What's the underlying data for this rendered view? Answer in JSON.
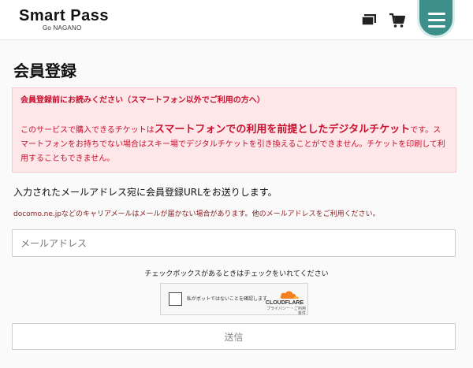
{
  "header": {
    "logo_main": "Smart Pass",
    "logo_sub": "Go NAGANO"
  },
  "page": {
    "title": "会員登録"
  },
  "notice": {
    "heading": "会員登録前にお読みください（スマートフォン以外でご利用の方へ）",
    "body_prefix": "このサービスで購入できるチケットは",
    "body_emphasis": "スマートフォンでの利用を前提としたデジタルチケット",
    "body_suffix": "です。スマートフォンをお持ちでない場合はスキー場でデジタルチケットを引き換えることができません。チケットを印刷して利用することもできません。"
  },
  "form": {
    "info_text": "入力されたメールアドレス宛に会員登録URLをお送りします。",
    "carrier_note": "docomo.ne.jpなどのキャリアメールはメールが届かない場合があります。他のメールアドレスをご利用ください。",
    "email_placeholder": "メールアドレス",
    "checkbox_note": "チェックボックスがあるときはチェックをいれてください",
    "submit_label": "送信"
  },
  "captcha": {
    "label": "私がボットではないことを確認します",
    "brand": "CLOUDFLARE",
    "links": "プライバシー・ご利用条件"
  },
  "colors": {
    "accent": "#3d8f8a",
    "notice_bg": "#fde7e9",
    "notice_text": "#c8102e",
    "carrier_text": "#8b1a1a"
  }
}
